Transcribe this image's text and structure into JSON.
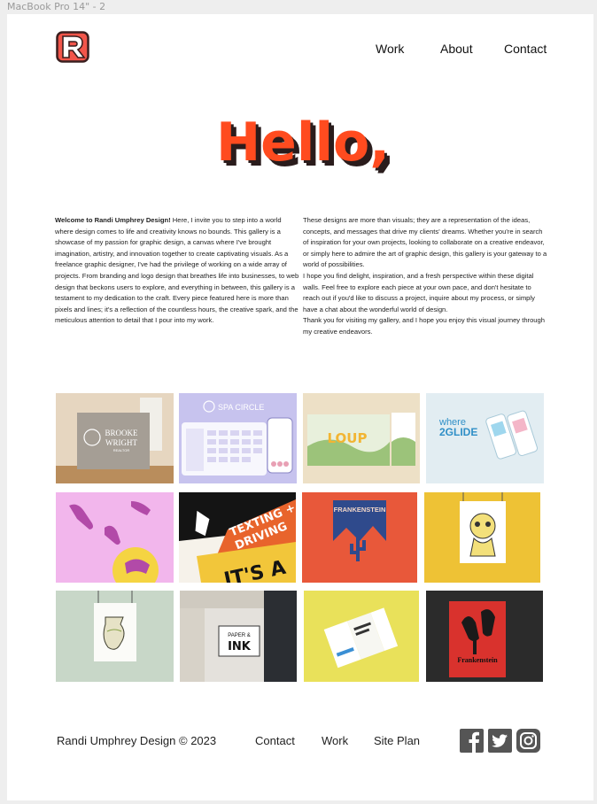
{
  "frame_label": "MacBook Pro 14\" - 2",
  "nav": {
    "work": "Work",
    "about": "About",
    "contact": "Contact"
  },
  "logo_letter": "R",
  "hero": {
    "text": "Hello,",
    "color": "#ff4b1f",
    "shadow": "#2a1c1c"
  },
  "intro": {
    "col1_bold": "Welcome to Randi Umphrey Design!",
    "col1_text": " Here, I invite you to step into a world where design comes to life and creativity knows no bounds. This gallery is a showcase of my passion for graphic design, a canvas where I've brought imagination, artistry, and innovation together to create captivating visuals. As a freelance graphic designer, I've had the privilege of working on a wide array of projects. From branding and logo design that breathes life into businesses, to web design that beckons users to explore, and everything in between, this gallery is a testament to my dedication to the craft. Every piece featured here is more than pixels and lines; it's a reflection of the countless hours, the creative spark, and the meticulous attention to detail that I pour into my work.",
    "col2_p1": "These designs are more than visuals; they are a representation of the ideas, concepts, and messages that drive my clients' dreams. Whether you're in search of inspiration for your own projects, looking to collaborate on a creative endeavor, or simply here to admire the art of graphic design, this gallery is your gateway to a world of possibilities.",
    "col2_p2": "I hope you find delight, inspiration, and a fresh perspective within these digital walls. Feel free to explore each piece at your own pace, and don't hesitate to reach out if you'd like to discuss a project, inquire about my process, or simply have a chat about the wonderful world of design.",
    "col2_p3": "Thank you for visiting my gallery, and I hope you enjoy this visual journey through my creative endeavors."
  },
  "gallery": {
    "brooke_line1": "BROOKE",
    "brooke_line2": "WRIGHT",
    "brooke_line3": "REALTOR",
    "spa_title": "SPA CIRCLE",
    "loup_title": "LOUP",
    "where_line1": "where",
    "where_line2": "2GLIDE",
    "texting_line1": "TEXTING +",
    "texting_line2": "DRIVING",
    "texting_line3": "IT'S A",
    "frank_title": "FRANKENSTEIN",
    "paper_small": "PAPER &",
    "paper_big": "INK",
    "frank2_title": "Frankenstein"
  },
  "footer": {
    "copyright": "Randi Umphrey Design © 2023",
    "contact": "Contact",
    "work": "Work",
    "site_plan": "Site Plan"
  },
  "icons": [
    "facebook-icon",
    "twitter-icon",
    "instagram-icon"
  ],
  "colors": {
    "accent": "#ff4b1f",
    "logo_border": "#3a1f1f",
    "logo_fill": "#f2554a"
  }
}
